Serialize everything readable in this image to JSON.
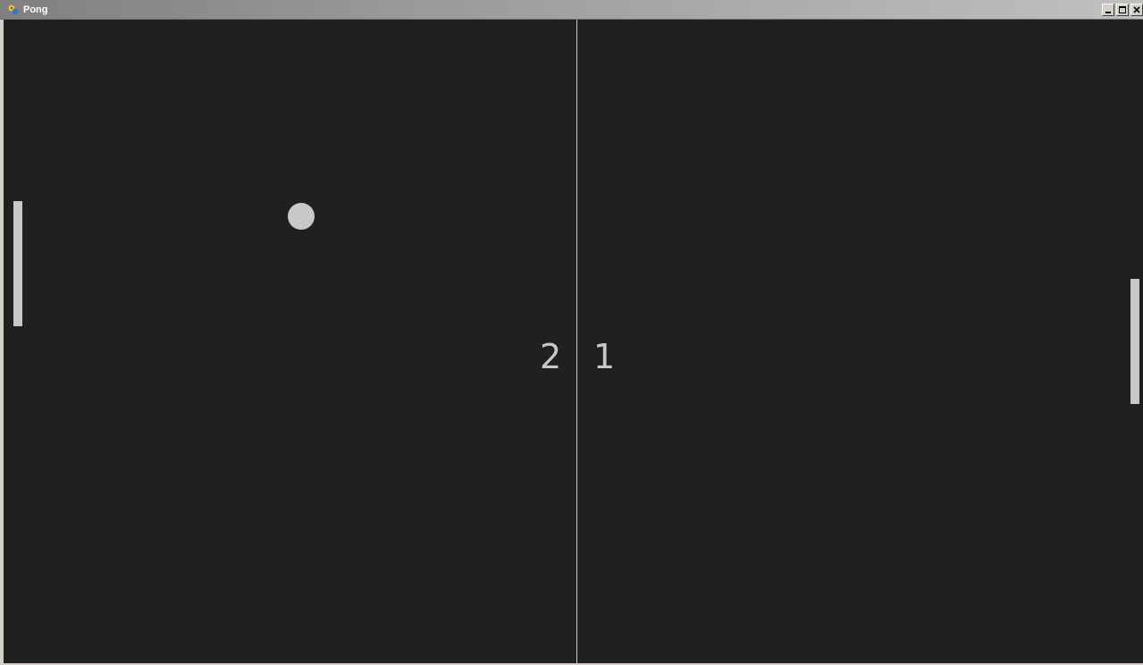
{
  "window": {
    "title": "Pong",
    "app_icon": "pygame-snake-icon",
    "controls": {
      "minimize_icon": "minimize-icon",
      "maximize_icon": "maximize-icon",
      "close_icon": "close-icon"
    }
  },
  "game": {
    "score_left": "2",
    "score_right": "1",
    "colors": {
      "background": "#202020",
      "foreground": "#c8c8c8"
    }
  }
}
